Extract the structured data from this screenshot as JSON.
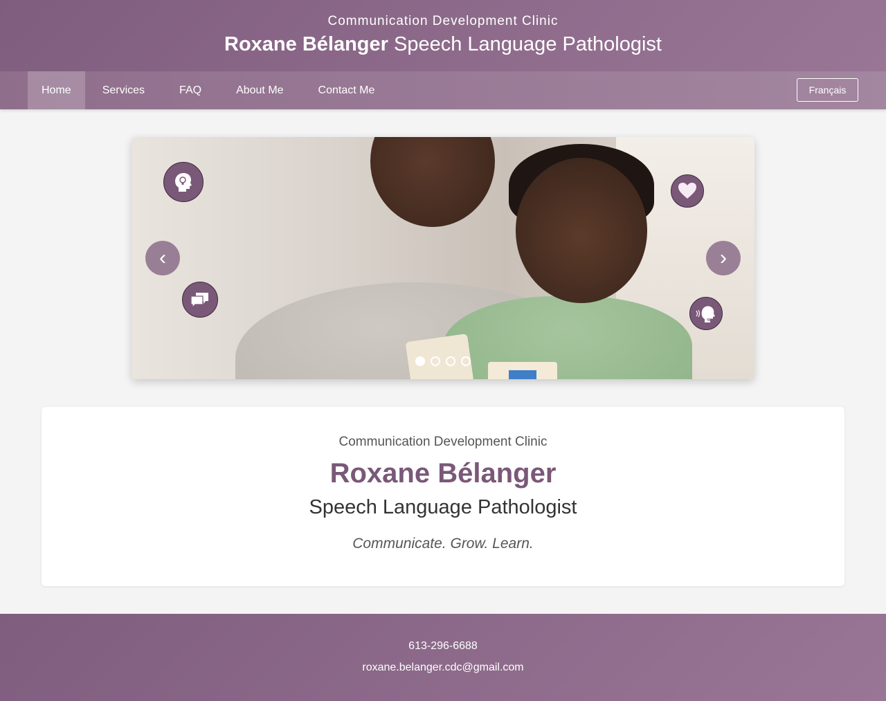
{
  "header": {
    "clinic_name": "Communication Development Clinic",
    "title_name": "Roxane Bélanger",
    "title_role": "Speech Language Pathologist"
  },
  "nav": {
    "items": [
      {
        "label": "Home",
        "active": true
      },
      {
        "label": "Services"
      },
      {
        "label": "FAQ"
      },
      {
        "label": "About Me"
      },
      {
        "label": "Contact Me"
      }
    ],
    "language_button": "Français"
  },
  "carousel": {
    "prev_label": "‹",
    "next_label": "›",
    "slide_count": 4,
    "active_slide": 1,
    "icons": [
      "head-lightbulb-icon",
      "speech-bubbles-icon",
      "heart-icon",
      "speaking-head-icon"
    ]
  },
  "card": {
    "clinic_name": "Communication Development Clinic",
    "name": "Roxane Bélanger",
    "role": "Speech Language Pathologist",
    "tagline": "Communicate. Grow. Learn."
  },
  "footer": {
    "phone": "613-296-6688",
    "email": "roxane.belanger.cdc@gmail.com"
  },
  "colors": {
    "brand": "#7f5d7e",
    "brand_light": "#9a7696",
    "accent_text": "#7a5878",
    "background": "#f4f4f4"
  }
}
